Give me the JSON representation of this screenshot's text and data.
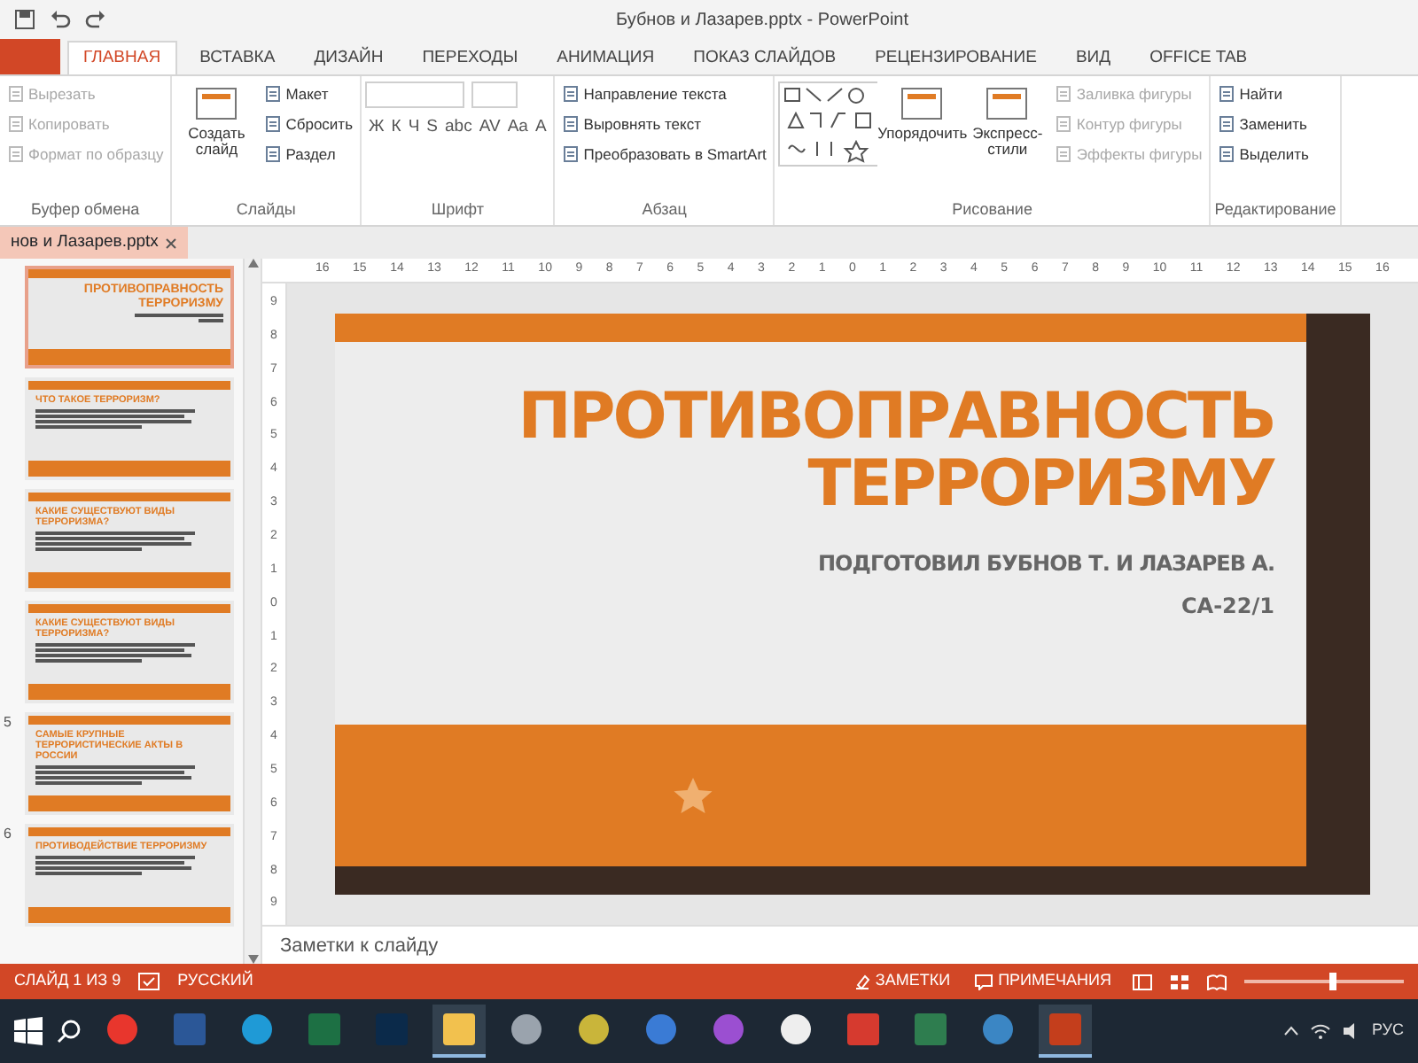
{
  "window": {
    "title": "Бубнов и Лазарев.pptx - PowerPoint"
  },
  "tabs": [
    {
      "kind": "file",
      "selected": false
    },
    {
      "label": "ГЛАВНАЯ",
      "kind": "tab",
      "selected": true
    },
    {
      "label": "ВСТАВКА",
      "kind": "tab",
      "selected": false
    },
    {
      "label": "ДИЗАЙН",
      "kind": "tab",
      "selected": false
    },
    {
      "label": "ПЕРЕХОДЫ",
      "kind": "tab",
      "selected": false
    },
    {
      "label": "АНИМАЦИЯ",
      "kind": "tab",
      "selected": false
    },
    {
      "label": "ПОКАЗ СЛАЙДОВ",
      "kind": "tab",
      "selected": false
    },
    {
      "label": "РЕЦЕНЗИРОВАНИЕ",
      "kind": "tab",
      "selected": false
    },
    {
      "label": "ВИД",
      "kind": "tab",
      "selected": false
    },
    {
      "label": "OFFICE TAB",
      "kind": "tab",
      "selected": false
    }
  ],
  "ribbon": [
    {
      "label": "Буфер обмена",
      "items": [
        {
          "kind": "small",
          "label": "Вырезать",
          "disabled": true
        },
        {
          "kind": "small",
          "label": "Копировать",
          "disabled": true
        },
        {
          "kind": "small",
          "label": "Формат по образцу",
          "disabled": true
        }
      ]
    },
    {
      "label": "Слайды",
      "items": [
        {
          "kind": "large",
          "label": "Создать слайд"
        },
        {
          "kind": "small",
          "label": "Макет",
          "disabled": false
        },
        {
          "kind": "small",
          "label": "Сбросить",
          "disabled": false
        },
        {
          "kind": "small",
          "label": "Раздел",
          "disabled": false
        }
      ]
    },
    {
      "label": "Шрифт",
      "items": [
        {
          "kind": "font",
          "glyphs": [
            "Ж",
            "К",
            "Ч",
            "S",
            "abc",
            "AV",
            "Aa",
            "A"
          ]
        }
      ]
    },
    {
      "label": "Абзац",
      "items": [
        {
          "kind": "small",
          "label": "Направление текста",
          "disabled": false
        },
        {
          "kind": "small",
          "label": "Выровнять текст",
          "disabled": false
        },
        {
          "kind": "small",
          "label": "Преобразовать в SmartArt",
          "disabled": false
        }
      ]
    },
    {
      "label": "Рисование",
      "items": [
        {
          "kind": "gallery"
        },
        {
          "kind": "large",
          "label": "Упорядочить"
        },
        {
          "kind": "large",
          "label": "Экспресс-стили"
        },
        {
          "kind": "small",
          "label": "Заливка фигуры",
          "disabled": true
        },
        {
          "kind": "small",
          "label": "Контур фигуры",
          "disabled": true
        },
        {
          "kind": "small",
          "label": "Эффекты фигуры",
          "disabled": true
        }
      ]
    },
    {
      "label": "Редактирование",
      "items": [
        {
          "kind": "small",
          "label": "Найти",
          "disabled": false
        },
        {
          "kind": "small",
          "label": "Заменить",
          "disabled": false
        },
        {
          "kind": "small",
          "label": "Выделить",
          "disabled": false
        }
      ]
    }
  ],
  "document_tab": {
    "label": "нов и Лазарев.pptx"
  },
  "thumbnails": [
    {
      "title": "ПРОТИВОПРАВНОСТЬ ТЕРРОРИЗМУ",
      "kind": "title",
      "selected": true
    },
    {
      "title": "ЧТО ТАКОЕ ТЕРРОРИЗМ?",
      "kind": "content",
      "selected": false
    },
    {
      "title": "КАКИЕ СУЩЕСТВУЮТ ВИДЫ ТЕРРОРИЗМА?",
      "kind": "content",
      "selected": false
    },
    {
      "title": "КАКИЕ СУЩЕСТВУЮТ ВИДЫ ТЕРРОРИЗМА?",
      "kind": "content",
      "selected": false
    },
    {
      "number": "5",
      "title": "САМЫЕ КРУПНЫЕ ТЕРРОРИСТИЧЕСКИЕ АКТЫ В РОССИИ",
      "kind": "content",
      "selected": false
    },
    {
      "number": "6",
      "title": "ПРОТИВОДЕЙСТВИЕ ТЕРРОРИЗМУ",
      "kind": "content",
      "selected": false
    }
  ],
  "ruler": {
    "horizontal": [
      "16",
      "15",
      "14",
      "13",
      "12",
      "11",
      "10",
      "9",
      "8",
      "7",
      "6",
      "5",
      "4",
      "3",
      "2",
      "1",
      "0",
      "1",
      "2",
      "3",
      "4",
      "5",
      "6",
      "7",
      "8",
      "9",
      "10",
      "11",
      "12",
      "13",
      "14",
      "15",
      "16"
    ],
    "vertical": [
      "9",
      "8",
      "7",
      "6",
      "5",
      "4",
      "3",
      "2",
      "1",
      "0",
      "1",
      "2",
      "3",
      "4",
      "5",
      "6",
      "7",
      "8",
      "9"
    ]
  },
  "slide": {
    "title": "ПРОТИВОПРАВНОСТЬ ТЕРРОРИЗМУ",
    "subtitle": "ПОДГОТОВИЛ БУБНОВ Т. И ЛАЗАРЕВ А.",
    "group": "СА-22/1"
  },
  "notes": {
    "placeholder": "Заметки к слайду"
  },
  "status_bar": {
    "slide_counter": "СЛАЙД 1 ИЗ 9",
    "language": "РУССКИЙ",
    "notes_button": "ЗАМЕТКИ",
    "comments_button": "ПРИМЕЧАНИЯ",
    "zoom": {
      "level": 0.55
    }
  },
  "taskbar": {
    "apps": [
      {
        "kind": "circle",
        "color": "#e8362d",
        "selected": false
      },
      {
        "kind": "square",
        "color": "#2b5797",
        "selected": false
      },
      {
        "kind": "circle",
        "color": "#1f9ad6",
        "selected": false
      },
      {
        "kind": "square",
        "color": "#1d7044",
        "selected": false
      },
      {
        "kind": "square",
        "color": "#0b2a4a",
        "selected": false
      },
      {
        "kind": "square",
        "color": "#f2c14e",
        "selected": true
      },
      {
        "kind": "circle",
        "color": "#9aa3ad",
        "selected": false
      },
      {
        "kind": "circle",
        "color": "#c9b53a",
        "selected": false
      },
      {
        "kind": "circle",
        "color": "#3a7bd5",
        "selected": false
      },
      {
        "kind": "circle",
        "color": "#9b4fd1",
        "selected": false
      },
      {
        "kind": "circle",
        "color": "#eeeeee",
        "selected": false
      },
      {
        "kind": "square",
        "color": "#d63a2f",
        "selected": false
      },
      {
        "kind": "square",
        "color": "#2e7d4f",
        "selected": false
      },
      {
        "kind": "circle",
        "color": "#3b86c4",
        "selected": false
      },
      {
        "kind": "square",
        "color": "#c43e1c",
        "selected": true
      }
    ],
    "language": "РУС"
  }
}
